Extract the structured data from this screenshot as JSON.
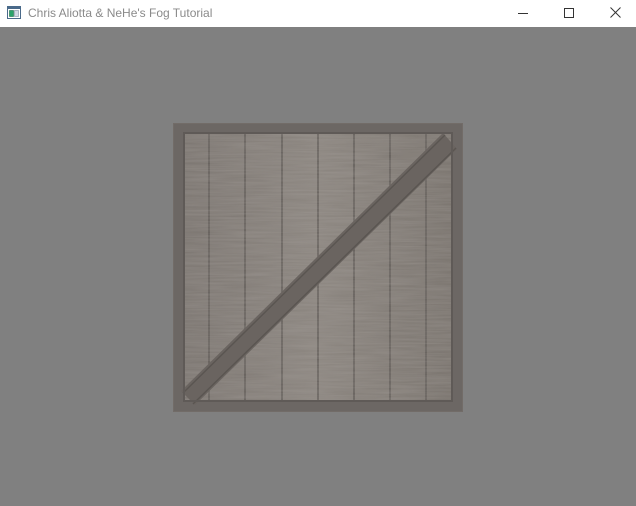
{
  "window": {
    "title": "Chris Aliotta & NeHe's Fog Tutorial"
  },
  "icons": {
    "app": "opengl-window-icon",
    "minimize": "minimize-icon",
    "maximize": "maximize-icon",
    "close": "close-icon"
  },
  "scene": {
    "background_color": "#808080",
    "object": "textured-wooden-crate",
    "fog_color": "#808080"
  }
}
